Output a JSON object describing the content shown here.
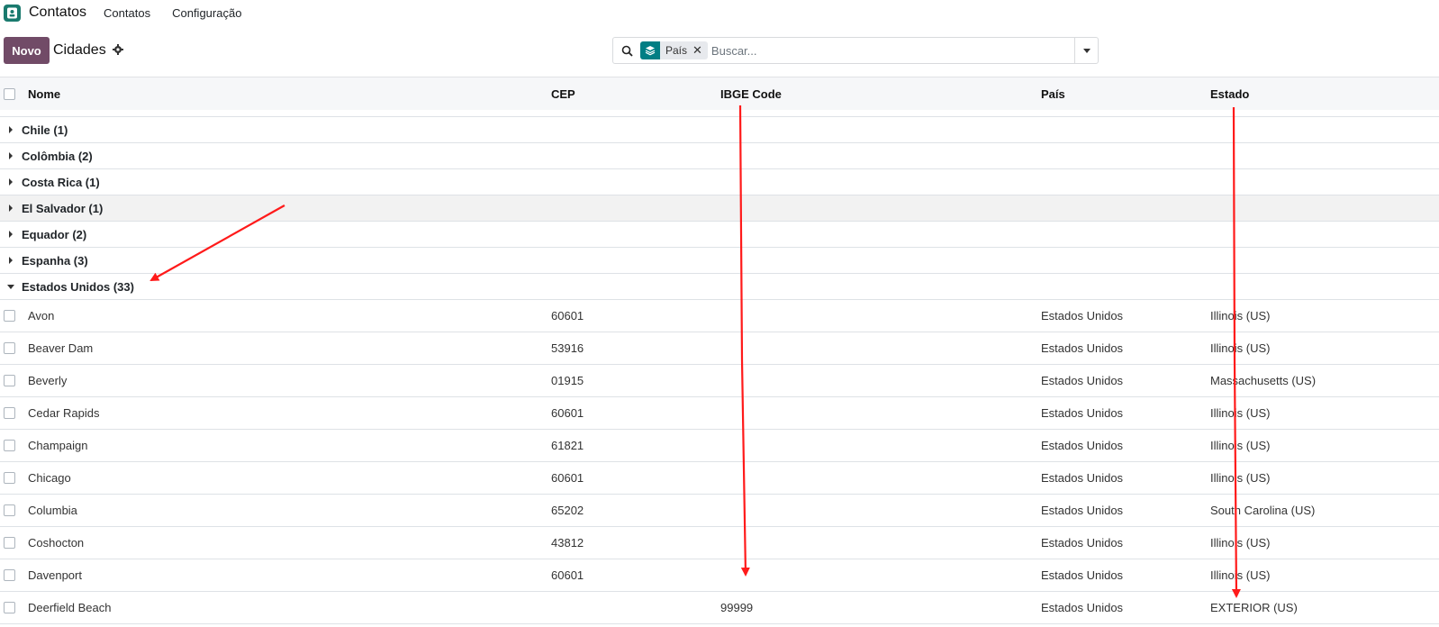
{
  "topnav": {
    "app_name": "Contatos",
    "items": [
      "Contatos",
      "Configuração"
    ]
  },
  "control": {
    "new_label": "Novo",
    "breadcrumb": "Cidades",
    "facet_label": "País",
    "search_placeholder": "Buscar..."
  },
  "table": {
    "headers": {
      "nome": "Nome",
      "cep": "CEP",
      "ibge": "IBGE Code",
      "pais": "País",
      "estado": "Estado"
    },
    "groups": [
      {
        "label": "Chile (1)"
      },
      {
        "label": "Colômbia (2)"
      },
      {
        "label": "Costa Rica (1)"
      },
      {
        "label": "El Salvador (1)"
      },
      {
        "label": "Equador (2)"
      },
      {
        "label": "Espanha (3)"
      },
      {
        "label": "Estados Unidos (33)"
      }
    ],
    "rows": [
      {
        "nome": "Avon",
        "cep": "60601",
        "ibge": "",
        "pais": "Estados Unidos",
        "estado": "Illinois (US)"
      },
      {
        "nome": "Beaver Dam",
        "cep": "53916",
        "ibge": "",
        "pais": "Estados Unidos",
        "estado": "Illinois (US)"
      },
      {
        "nome": "Beverly",
        "cep": "01915",
        "ibge": "",
        "pais": "Estados Unidos",
        "estado": "Massachusetts (US)"
      },
      {
        "nome": "Cedar Rapids",
        "cep": "60601",
        "ibge": "",
        "pais": "Estados Unidos",
        "estado": "Illinois (US)"
      },
      {
        "nome": "Champaign",
        "cep": "61821",
        "ibge": "",
        "pais": "Estados Unidos",
        "estado": "Illinois (US)"
      },
      {
        "nome": "Chicago",
        "cep": "60601",
        "ibge": "",
        "pais": "Estados Unidos",
        "estado": "Illinois (US)"
      },
      {
        "nome": "Columbia",
        "cep": "65202",
        "ibge": "",
        "pais": "Estados Unidos",
        "estado": "South Carolina (US)"
      },
      {
        "nome": "Coshocton",
        "cep": "43812",
        "ibge": "",
        "pais": "Estados Unidos",
        "estado": "Illinois (US)"
      },
      {
        "nome": "Davenport",
        "cep": "60601",
        "ibge": "",
        "pais": "Estados Unidos",
        "estado": "Illinois (US)"
      },
      {
        "nome": "Deerfield Beach",
        "cep": "",
        "ibge": "99999",
        "pais": "Estados Unidos",
        "estado": "EXTERIOR (US)"
      }
    ]
  },
  "colors": {
    "brand": "#714b67",
    "facet": "#017e84",
    "annotation": "#ff1a1a"
  }
}
